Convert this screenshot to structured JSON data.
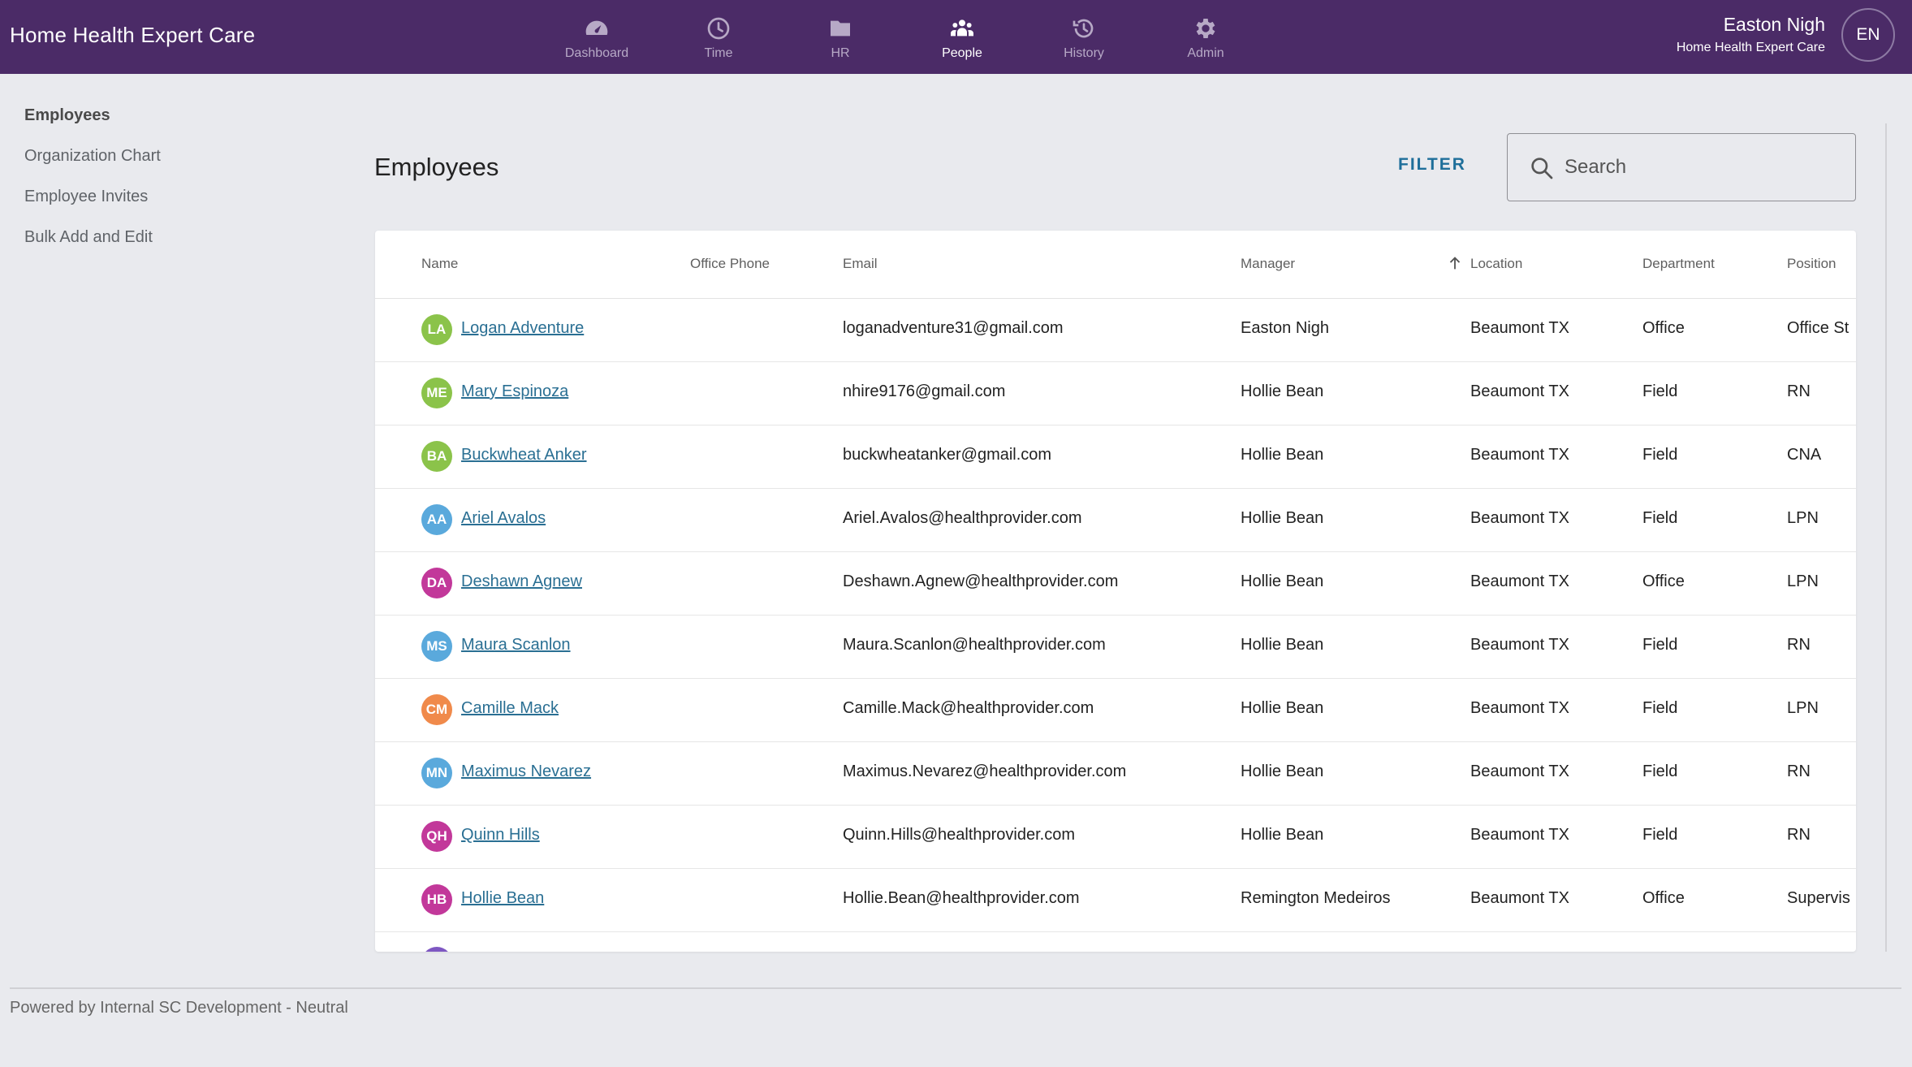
{
  "app": {
    "brand": "Home Health Expert Care"
  },
  "nav": [
    {
      "label": "Dashboard",
      "icon": "dashboard-gauge-icon",
      "active": false
    },
    {
      "label": "Time",
      "icon": "clock-icon",
      "active": false
    },
    {
      "label": "HR",
      "icon": "folder-icon",
      "active": false
    },
    {
      "label": "People",
      "icon": "people-icon",
      "active": true
    },
    {
      "label": "History",
      "icon": "history-icon",
      "active": false
    },
    {
      "label": "Admin",
      "icon": "gear-icon",
      "active": false
    }
  ],
  "user": {
    "name": "Easton Nigh",
    "org": "Home Health Expert Care",
    "initials": "EN"
  },
  "sidebar": {
    "items": [
      {
        "label": "Employees",
        "active": true
      },
      {
        "label": "Organization Chart",
        "active": false
      },
      {
        "label": "Employee Invites",
        "active": false
      },
      {
        "label": "Bulk Add and Edit",
        "active": false
      }
    ]
  },
  "main": {
    "title": "Employees",
    "filter_label": "FILTER",
    "search_placeholder": "Search"
  },
  "table": {
    "columns": {
      "name": "Name",
      "office_phone": "Office Phone",
      "email": "Email",
      "manager": "Manager",
      "location": "Location",
      "department": "Department",
      "position": "Position"
    },
    "sorted_column": "location",
    "sort_direction": "ascending",
    "rows": [
      {
        "initials": "LA",
        "color": "#8bc34a",
        "name": "Logan Adventure",
        "phone": "",
        "email": "loganadventure31@gmail.com",
        "manager": "Easton Nigh",
        "location": "Beaumont TX",
        "department": "Office",
        "position": "Office St"
      },
      {
        "initials": "ME",
        "color": "#8bc34a",
        "name": "Mary Espinoza",
        "phone": "",
        "email": "nhire9176@gmail.com",
        "manager": "Hollie Bean",
        "location": "Beaumont TX",
        "department": "Field",
        "position": "RN"
      },
      {
        "initials": "BA",
        "color": "#8bc34a",
        "name": "Buckwheat Anker",
        "phone": "",
        "email": "buckwheatanker@gmail.com",
        "manager": "Hollie Bean",
        "location": "Beaumont TX",
        "department": "Field",
        "position": "CNA"
      },
      {
        "initials": "AA",
        "color": "#5aa9dc",
        "name": "Ariel Avalos",
        "phone": "",
        "email": "Ariel.Avalos@healthprovider.com",
        "manager": "Hollie Bean",
        "location": "Beaumont TX",
        "department": "Field",
        "position": "LPN"
      },
      {
        "initials": "DA",
        "color": "#c2389a",
        "name": "Deshawn Agnew",
        "phone": "",
        "email": "Deshawn.Agnew@healthprovider.com",
        "manager": "Hollie Bean",
        "location": "Beaumont TX",
        "department": "Office",
        "position": "LPN"
      },
      {
        "initials": "MS",
        "color": "#5aa9dc",
        "name": "Maura Scanlon",
        "phone": "",
        "email": "Maura.Scanlon@healthprovider.com",
        "manager": "Hollie Bean",
        "location": "Beaumont TX",
        "department": "Field",
        "position": "RN"
      },
      {
        "initials": "CM",
        "color": "#f08a4b",
        "name": "Camille Mack",
        "phone": "",
        "email": "Camille.Mack@healthprovider.com",
        "manager": "Hollie Bean",
        "location": "Beaumont TX",
        "department": "Field",
        "position": "LPN"
      },
      {
        "initials": "MN",
        "color": "#5aa9dc",
        "name": "Maximus Nevarez",
        "phone": "",
        "email": "Maximus.Nevarez@healthprovider.com",
        "manager": "Hollie Bean",
        "location": "Beaumont TX",
        "department": "Field",
        "position": "RN"
      },
      {
        "initials": "QH",
        "color": "#c2389a",
        "name": "Quinn Hills",
        "phone": "",
        "email": "Quinn.Hills@healthprovider.com",
        "manager": "Hollie Bean",
        "location": "Beaumont TX",
        "department": "Field",
        "position": "RN"
      },
      {
        "initials": "HB",
        "color": "#c2389a",
        "name": "Hollie Bean",
        "phone": "",
        "email": "Hollie.Bean@healthprovider.com",
        "manager": "Remington Medeiros",
        "location": "Beaumont TX",
        "department": "Office",
        "position": "Supervis"
      }
    ]
  },
  "footer": {
    "text": "Powered by Internal SC Development - Neutral"
  }
}
